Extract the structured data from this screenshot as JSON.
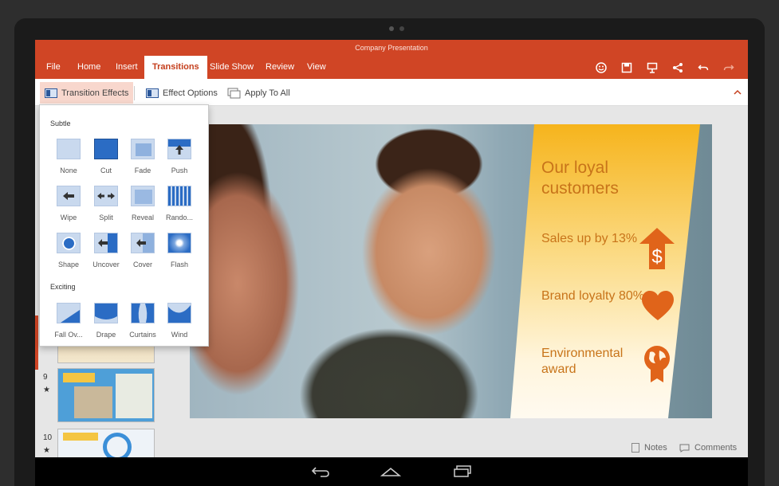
{
  "window": {
    "title": "Company Presentation"
  },
  "menu": {
    "items": [
      {
        "label": "File"
      },
      {
        "label": "Home"
      },
      {
        "label": "Insert"
      },
      {
        "label": "Transitions"
      },
      {
        "label": "Slide Show"
      },
      {
        "label": "Review"
      },
      {
        "label": "View"
      }
    ],
    "active": "Transitions",
    "icons": [
      "smiley-icon",
      "save-icon",
      "present-icon",
      "share-icon",
      "undo-icon",
      "redo-icon"
    ]
  },
  "ribbon": {
    "transition_effects": "Transition Effects",
    "effect_options": "Effect Options",
    "apply_to_all": "Apply To All"
  },
  "dropdown": {
    "subtle_heading": "Subtle",
    "exciting_heading": "Exciting",
    "subtle": [
      {
        "label": "None"
      },
      {
        "label": "Cut"
      },
      {
        "label": "Fade"
      },
      {
        "label": "Push"
      },
      {
        "label": "Wipe"
      },
      {
        "label": "Split"
      },
      {
        "label": "Reveal"
      },
      {
        "label": "Rando..."
      },
      {
        "label": "Shape"
      },
      {
        "label": "Uncover"
      },
      {
        "label": "Cover"
      },
      {
        "label": "Flash"
      }
    ],
    "exciting": [
      {
        "label": "Fall Ov..."
      },
      {
        "label": "Drape"
      },
      {
        "label": "Curtains"
      },
      {
        "label": "Wind"
      }
    ]
  },
  "thumbnails": {
    "slide9_num": "9",
    "slide10_num": "10",
    "star": "★"
  },
  "slide": {
    "title": "Our loyal customers",
    "stats": [
      {
        "text": "Sales up by 13%"
      },
      {
        "text": "Brand loyalty 80%"
      },
      {
        "text": "Environmental award"
      }
    ],
    "accent_color": "#f6b41c",
    "text_color": "#c8741a",
    "icon_color": "#e0641a"
  },
  "bottom": {
    "notes": "Notes",
    "comments": "Comments"
  },
  "colors": {
    "brand": "#d04525"
  }
}
